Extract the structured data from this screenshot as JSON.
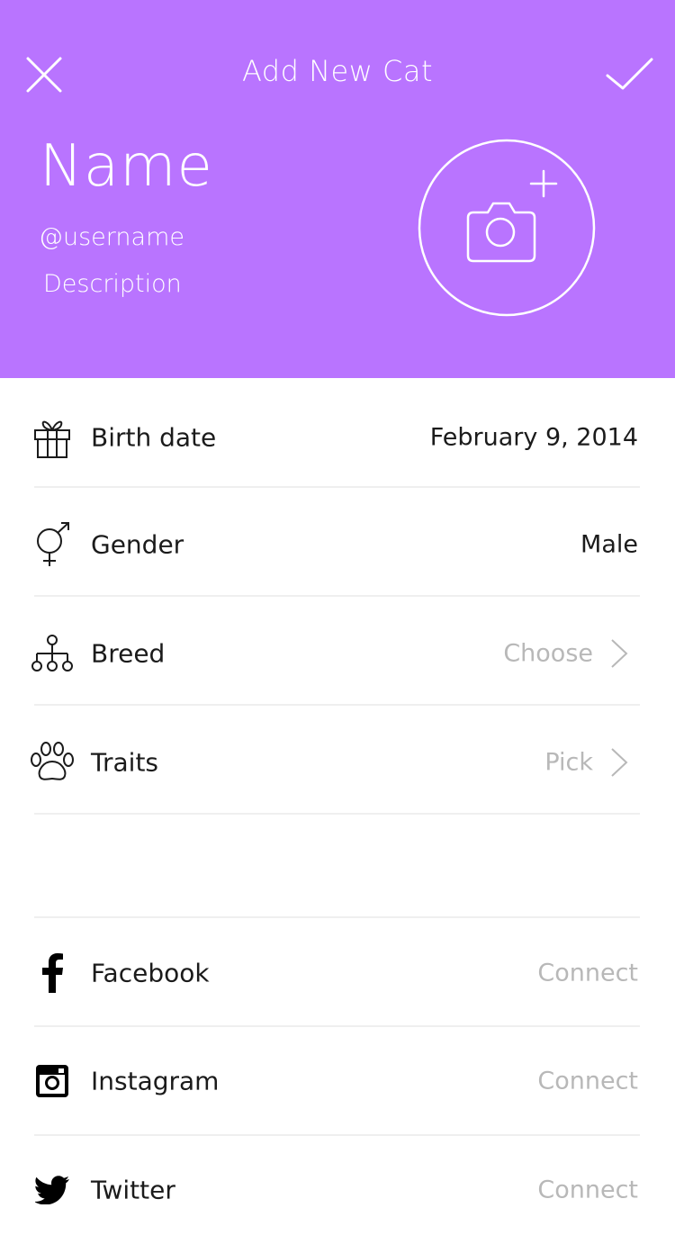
{
  "header": {
    "title": "Add New Cat",
    "close_icon": "close-icon",
    "confirm_icon": "checkmark-icon",
    "name": "Name",
    "username": "@username",
    "description": "Description",
    "photo_icon": "camera-add-icon",
    "background_color": "#b974ff"
  },
  "details": [
    {
      "icon": "gift-icon",
      "label": "Birth date",
      "value": "February 9, 2014"
    },
    {
      "icon": "gender-icon",
      "label": "Gender",
      "value": "Male"
    },
    {
      "icon": "hierarchy-icon",
      "label": "Breed",
      "value": "Choose"
    },
    {
      "icon": "paw-icon",
      "label": "Traits",
      "value": "Pick"
    }
  ],
  "social": [
    {
      "icon": "facebook-icon",
      "label": "Facebook",
      "value": "Connect"
    },
    {
      "icon": "instagram-icon",
      "label": "Instagram",
      "value": "Connect"
    },
    {
      "icon": "twitter-icon",
      "label": "Twitter",
      "value": "Connect"
    }
  ],
  "colors": {
    "accent": "#b974ff",
    "muted_text": "#b8b8b8",
    "divider": "#efefef"
  }
}
